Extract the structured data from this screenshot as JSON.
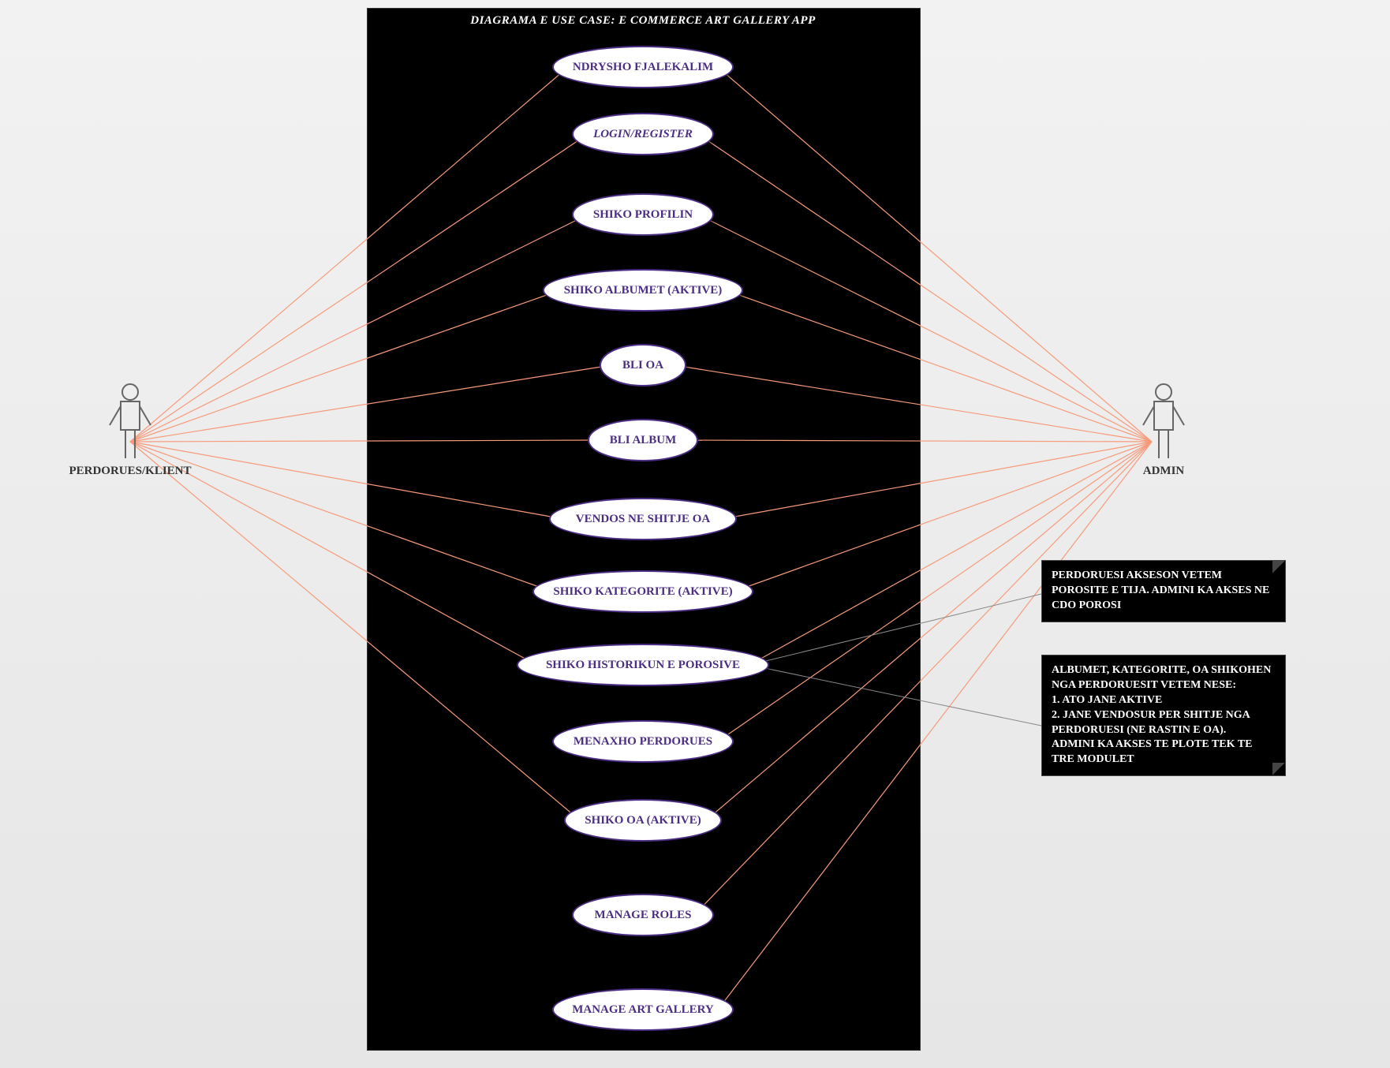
{
  "diagram": {
    "title": "DIAGRAMA E USE CASE: E COMMERCE ART GALLERY APP",
    "actors": {
      "user": {
        "label": "PERDORUES/KLIENT"
      },
      "admin": {
        "label": "ADMIN"
      }
    },
    "use_cases": [
      {
        "id": "uc0",
        "label": "NDRYSHO FJALEKALIM",
        "italic": false
      },
      {
        "id": "uc1",
        "label": "LOGIN/REGISTER",
        "italic": true
      },
      {
        "id": "uc2",
        "label": "SHIKO PROFILIN",
        "italic": false
      },
      {
        "id": "uc3",
        "label": "SHIKO ALBUMET (AKTIVE)",
        "italic": false
      },
      {
        "id": "uc4",
        "label": "BLI OA",
        "italic": false
      },
      {
        "id": "uc5",
        "label": "BLI ALBUM",
        "italic": false
      },
      {
        "id": "uc6",
        "label": "VENDOS NE SHITJE OA",
        "italic": false
      },
      {
        "id": "uc7",
        "label": "SHIKO KATEGORITE (AKTIVE)",
        "italic": false
      },
      {
        "id": "uc8",
        "label": "SHIKO HISTORIKUN E POROSIVE",
        "italic": false
      },
      {
        "id": "uc9",
        "label": "MENAXHO PERDORUES",
        "italic": false
      },
      {
        "id": "uc10",
        "label": "SHIKO OA (AKTIVE)",
        "italic": false
      },
      {
        "id": "uc11",
        "label": "MANAGE ROLES",
        "italic": false
      },
      {
        "id": "uc12",
        "label": "MANAGE ART GALLERY",
        "italic": false
      }
    ],
    "notes": {
      "n1": "PERDORUESI AKSESON VETEM POROSITE E TIJA. ADMINI KA AKSES NE CDO POROSI",
      "n2": "ALBUMET, KATEGORITE, OA SHIKOHEN NGA PERDORUESIT VETEM NESE:\n1. ATO JANE AKTIVE\n2. JANE VENDOSUR PER SHITJE NGA PERDORUESI (NE RASTIN E OA).\nADMINI KA AKSES TE PLOTE TEK TE TRE MODULET"
    },
    "colors": {
      "connector": "#f79a7a",
      "noteLine": "#888888",
      "ellipseBorder": "#4b2e83",
      "ellipseText": "#4b2e83",
      "systemFill": "#000000",
      "systemText": "#ffffff"
    }
  }
}
